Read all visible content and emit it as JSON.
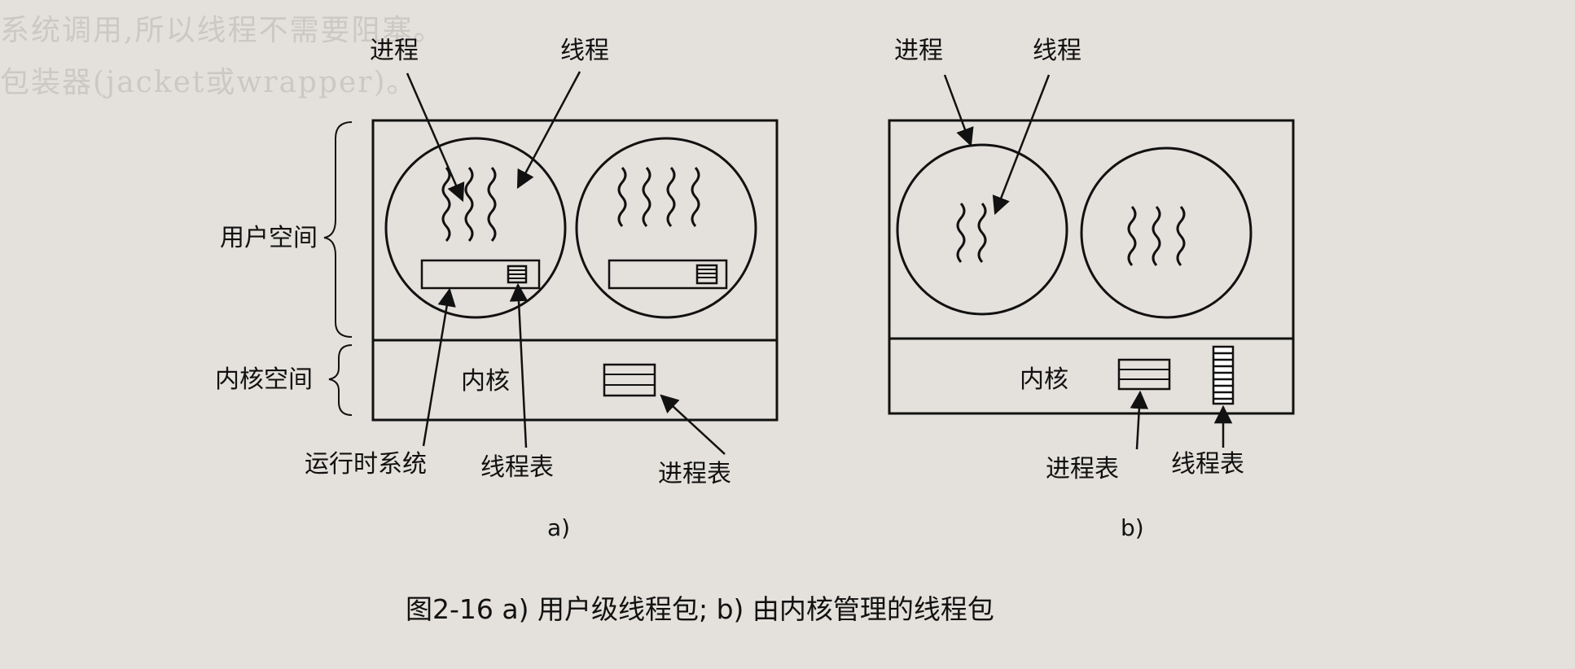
{
  "background_colors": {
    "paper": "#e4e1dc",
    "ink": "#111111",
    "bleed_text": "#b9b5ae"
  },
  "bleed_through": {
    "line1": "系统调用,所以线程不需要阻塞。",
    "line2": "包装器(jacket或wrapper)。"
  },
  "diagram_a": {
    "labels": {
      "process": "进程",
      "thread": "线程",
      "user_space": "用户空间",
      "kernel_space": "内核空间",
      "kernel": "内核",
      "runtime_system": "运行时系统",
      "thread_table": "线程表",
      "process_table": "进程表"
    },
    "sublabel": "a)"
  },
  "diagram_b": {
    "labels": {
      "process": "进程",
      "thread": "线程",
      "kernel": "内核",
      "process_table": "进程表",
      "thread_table": "线程表"
    },
    "sublabel": "b)"
  },
  "caption": "图2-16  a) 用户级线程包; b) 由内核管理的线程包"
}
